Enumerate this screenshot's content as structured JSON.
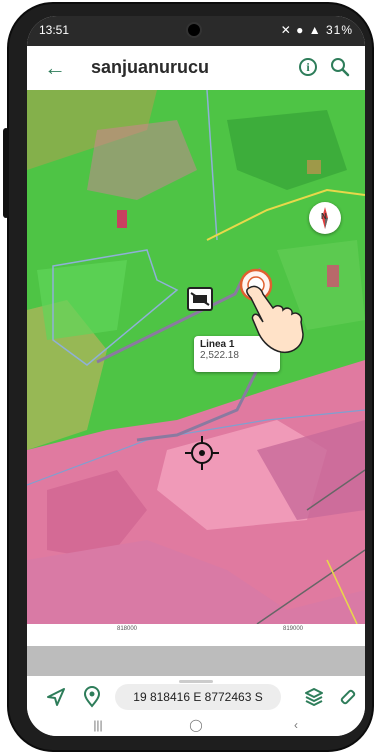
{
  "status": {
    "time": "13:51",
    "battery": "31%"
  },
  "header": {
    "title": "sanjuanurucu"
  },
  "map": {
    "tooltip": {
      "line_name": "Linea 1",
      "line_length": "2,522.18"
    },
    "compass_label": "N"
  },
  "scale": {
    "tick_left": "818000",
    "tick_right": "819000"
  },
  "footer": {
    "coordinates": "19 818416 E 8772463 S"
  },
  "colors": {
    "accent": "#2e7d5a",
    "line": "#8a7aa0",
    "veg": "#4ec445",
    "bare": "#e07aa0"
  }
}
